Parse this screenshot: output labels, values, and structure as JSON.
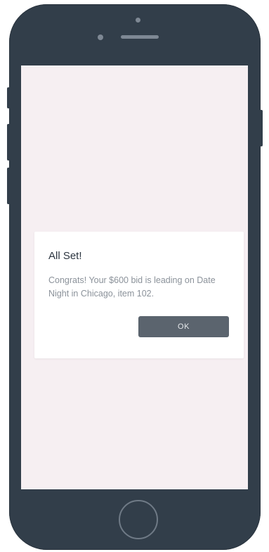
{
  "dialog": {
    "title": "All Set!",
    "message": "Congrats! Your $600 bid is leading on Date Night in Chicago, item 102.",
    "ok_label": "OK"
  },
  "colors": {
    "phone_body": "#323e4a",
    "screen_background": "#f6eff2",
    "dialog_background": "#ffffff",
    "button_background": "#5b646e",
    "title_text": "#2c3540",
    "message_text": "#8b929a"
  }
}
